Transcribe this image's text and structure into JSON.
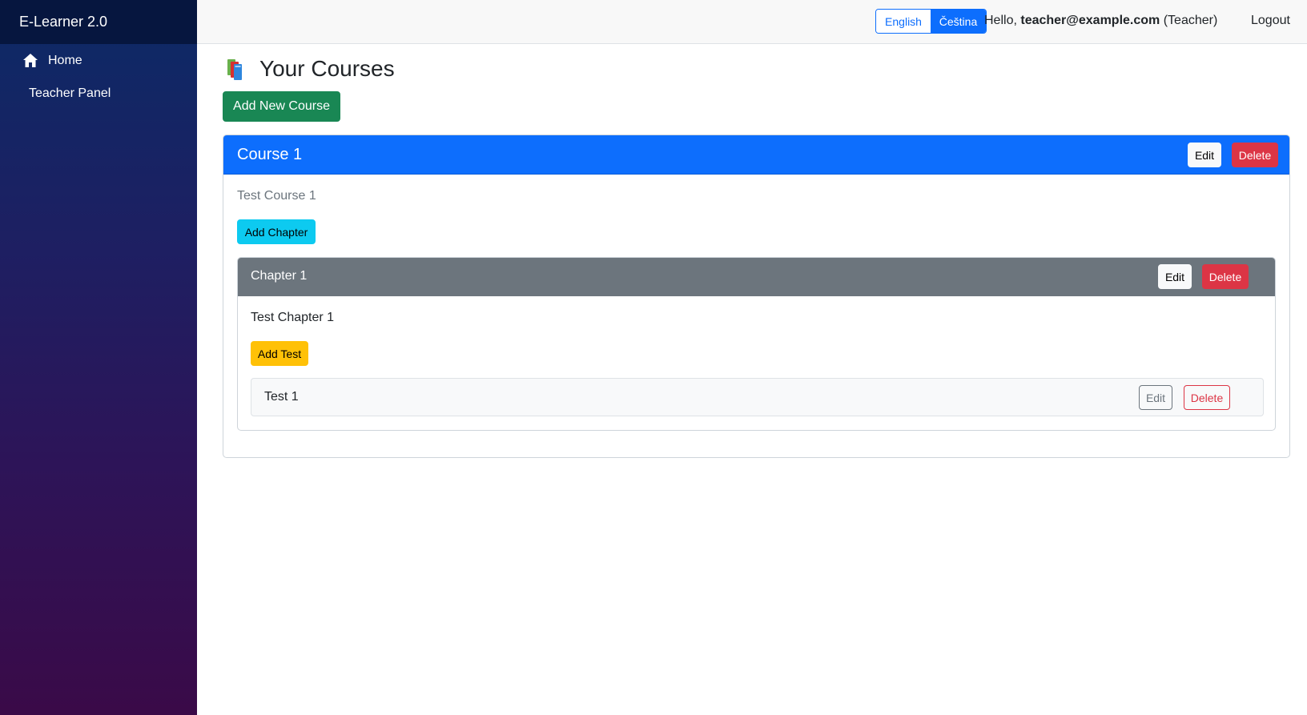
{
  "sidebar": {
    "brand": "E-Learner 2.0",
    "items": [
      {
        "label": "Home",
        "icon": "home-icon"
      },
      {
        "label": "Teacher Panel"
      }
    ]
  },
  "topbar": {
    "languages": [
      "English",
      "Čeština"
    ],
    "active_language": "Čeština",
    "greeting_prefix": "Hello,",
    "user_email": "teacher@example.com",
    "user_role": "(Teacher)",
    "logout_label": "Logout"
  },
  "main": {
    "title": "Your Courses",
    "title_icon": "books-icon",
    "add_course_label": "Add New Course",
    "courses": [
      {
        "title": "Course 1",
        "description": "Test Course 1",
        "edit_label": "Edit",
        "delete_label": "Delete",
        "add_chapter_label": "Add Chapter",
        "chapters": [
          {
            "title": "Chapter 1",
            "description": "Test Chapter 1",
            "edit_label": "Edit",
            "delete_label": "Delete",
            "add_test_label": "Add Test",
            "tests": [
              {
                "title": "Test 1",
                "edit_label": "Edit",
                "delete_label": "Delete"
              }
            ]
          }
        ]
      }
    ]
  },
  "colors": {
    "primary": "#0d6efd",
    "success": "#198754",
    "danger": "#dc3545",
    "info": "#0dcaf0",
    "warning": "#ffc107",
    "secondary": "#6c757d"
  }
}
